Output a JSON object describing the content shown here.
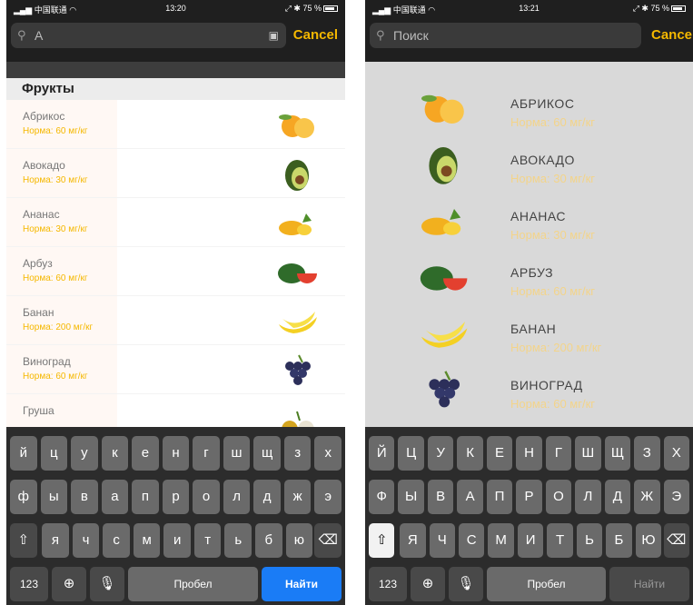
{
  "left_screen": {
    "status": {
      "carrier": "中国联通",
      "time": "13:20",
      "battery": "75 %"
    },
    "search": {
      "value": "А",
      "cancel": "Cancel"
    },
    "section_title": "Фрукты",
    "items": [
      {
        "name": "Абрикос",
        "norm": "Норма: 60 мг/кг",
        "icon": "apricot-icon"
      },
      {
        "name": "Авокадо",
        "norm": "Норма: 30 мг/кг",
        "icon": "avocado-icon"
      },
      {
        "name": "Ананас",
        "norm": "Норма: 30 мг/кг",
        "icon": "pineapple-icon"
      },
      {
        "name": "Арбуз",
        "norm": "Норма: 60 мг/кг",
        "icon": "watermelon-icon"
      },
      {
        "name": "Банан",
        "norm": "Норма: 200 мг/кг",
        "icon": "banana-icon"
      },
      {
        "name": "Виноград",
        "norm": "Норма: 60 мг/кг",
        "icon": "grapes-icon"
      },
      {
        "name": "Груша",
        "norm": "",
        "icon": "pear-icon"
      }
    ],
    "keyboard": {
      "row1": [
        "й",
        "ц",
        "у",
        "к",
        "е",
        "н",
        "г",
        "ш",
        "щ",
        "з",
        "х"
      ],
      "row2": [
        "ф",
        "ы",
        "в",
        "а",
        "п",
        "р",
        "о",
        "л",
        "д",
        "ж",
        "э"
      ],
      "row3": [
        "я",
        "ч",
        "с",
        "м",
        "и",
        "т",
        "ь",
        "б",
        "ю"
      ],
      "numbers": "123",
      "space": "Пробел",
      "action": "Найти"
    }
  },
  "right_screen": {
    "status": {
      "carrier": "中国联通",
      "time": "13:21",
      "battery": "75 %"
    },
    "search": {
      "placeholder": "Поиск",
      "cancel": "Cance"
    },
    "items": [
      {
        "name": "АБРИКОС",
        "norm": "Норма: 60 мг/кг",
        "icon": "apricot-icon"
      },
      {
        "name": "АВОКАДО",
        "norm": "Норма: 30 мг/кг",
        "icon": "avocado-icon"
      },
      {
        "name": "АНАНАС",
        "norm": "Норма: 30 мг/кг",
        "icon": "pineapple-icon"
      },
      {
        "name": "АРБУЗ",
        "norm": "Норма: 60 мг/кг",
        "icon": "watermelon-icon"
      },
      {
        "name": "БАНАН",
        "norm": "Норма: 200 мг/кг",
        "icon": "banana-icon"
      },
      {
        "name": "ВИНОГРАД",
        "norm": "Норма: 60 мг/кг",
        "icon": "grapes-icon"
      }
    ],
    "keyboard": {
      "row1": [
        "Й",
        "Ц",
        "У",
        "К",
        "Е",
        "Н",
        "Г",
        "Ш",
        "Щ",
        "З",
        "Х"
      ],
      "row2": [
        "Ф",
        "Ы",
        "В",
        "А",
        "П",
        "Р",
        "О",
        "Л",
        "Д",
        "Ж",
        "Э"
      ],
      "row3": [
        "Я",
        "Ч",
        "С",
        "М",
        "И",
        "Т",
        "Ь",
        "Б",
        "Ю"
      ],
      "numbers": "123",
      "space": "Пробел",
      "action": "Найти"
    }
  },
  "colors": {
    "accent": "#f5b800",
    "keyboard_blue": "#1a7cf6",
    "dark_bar": "#1f1f1f"
  }
}
